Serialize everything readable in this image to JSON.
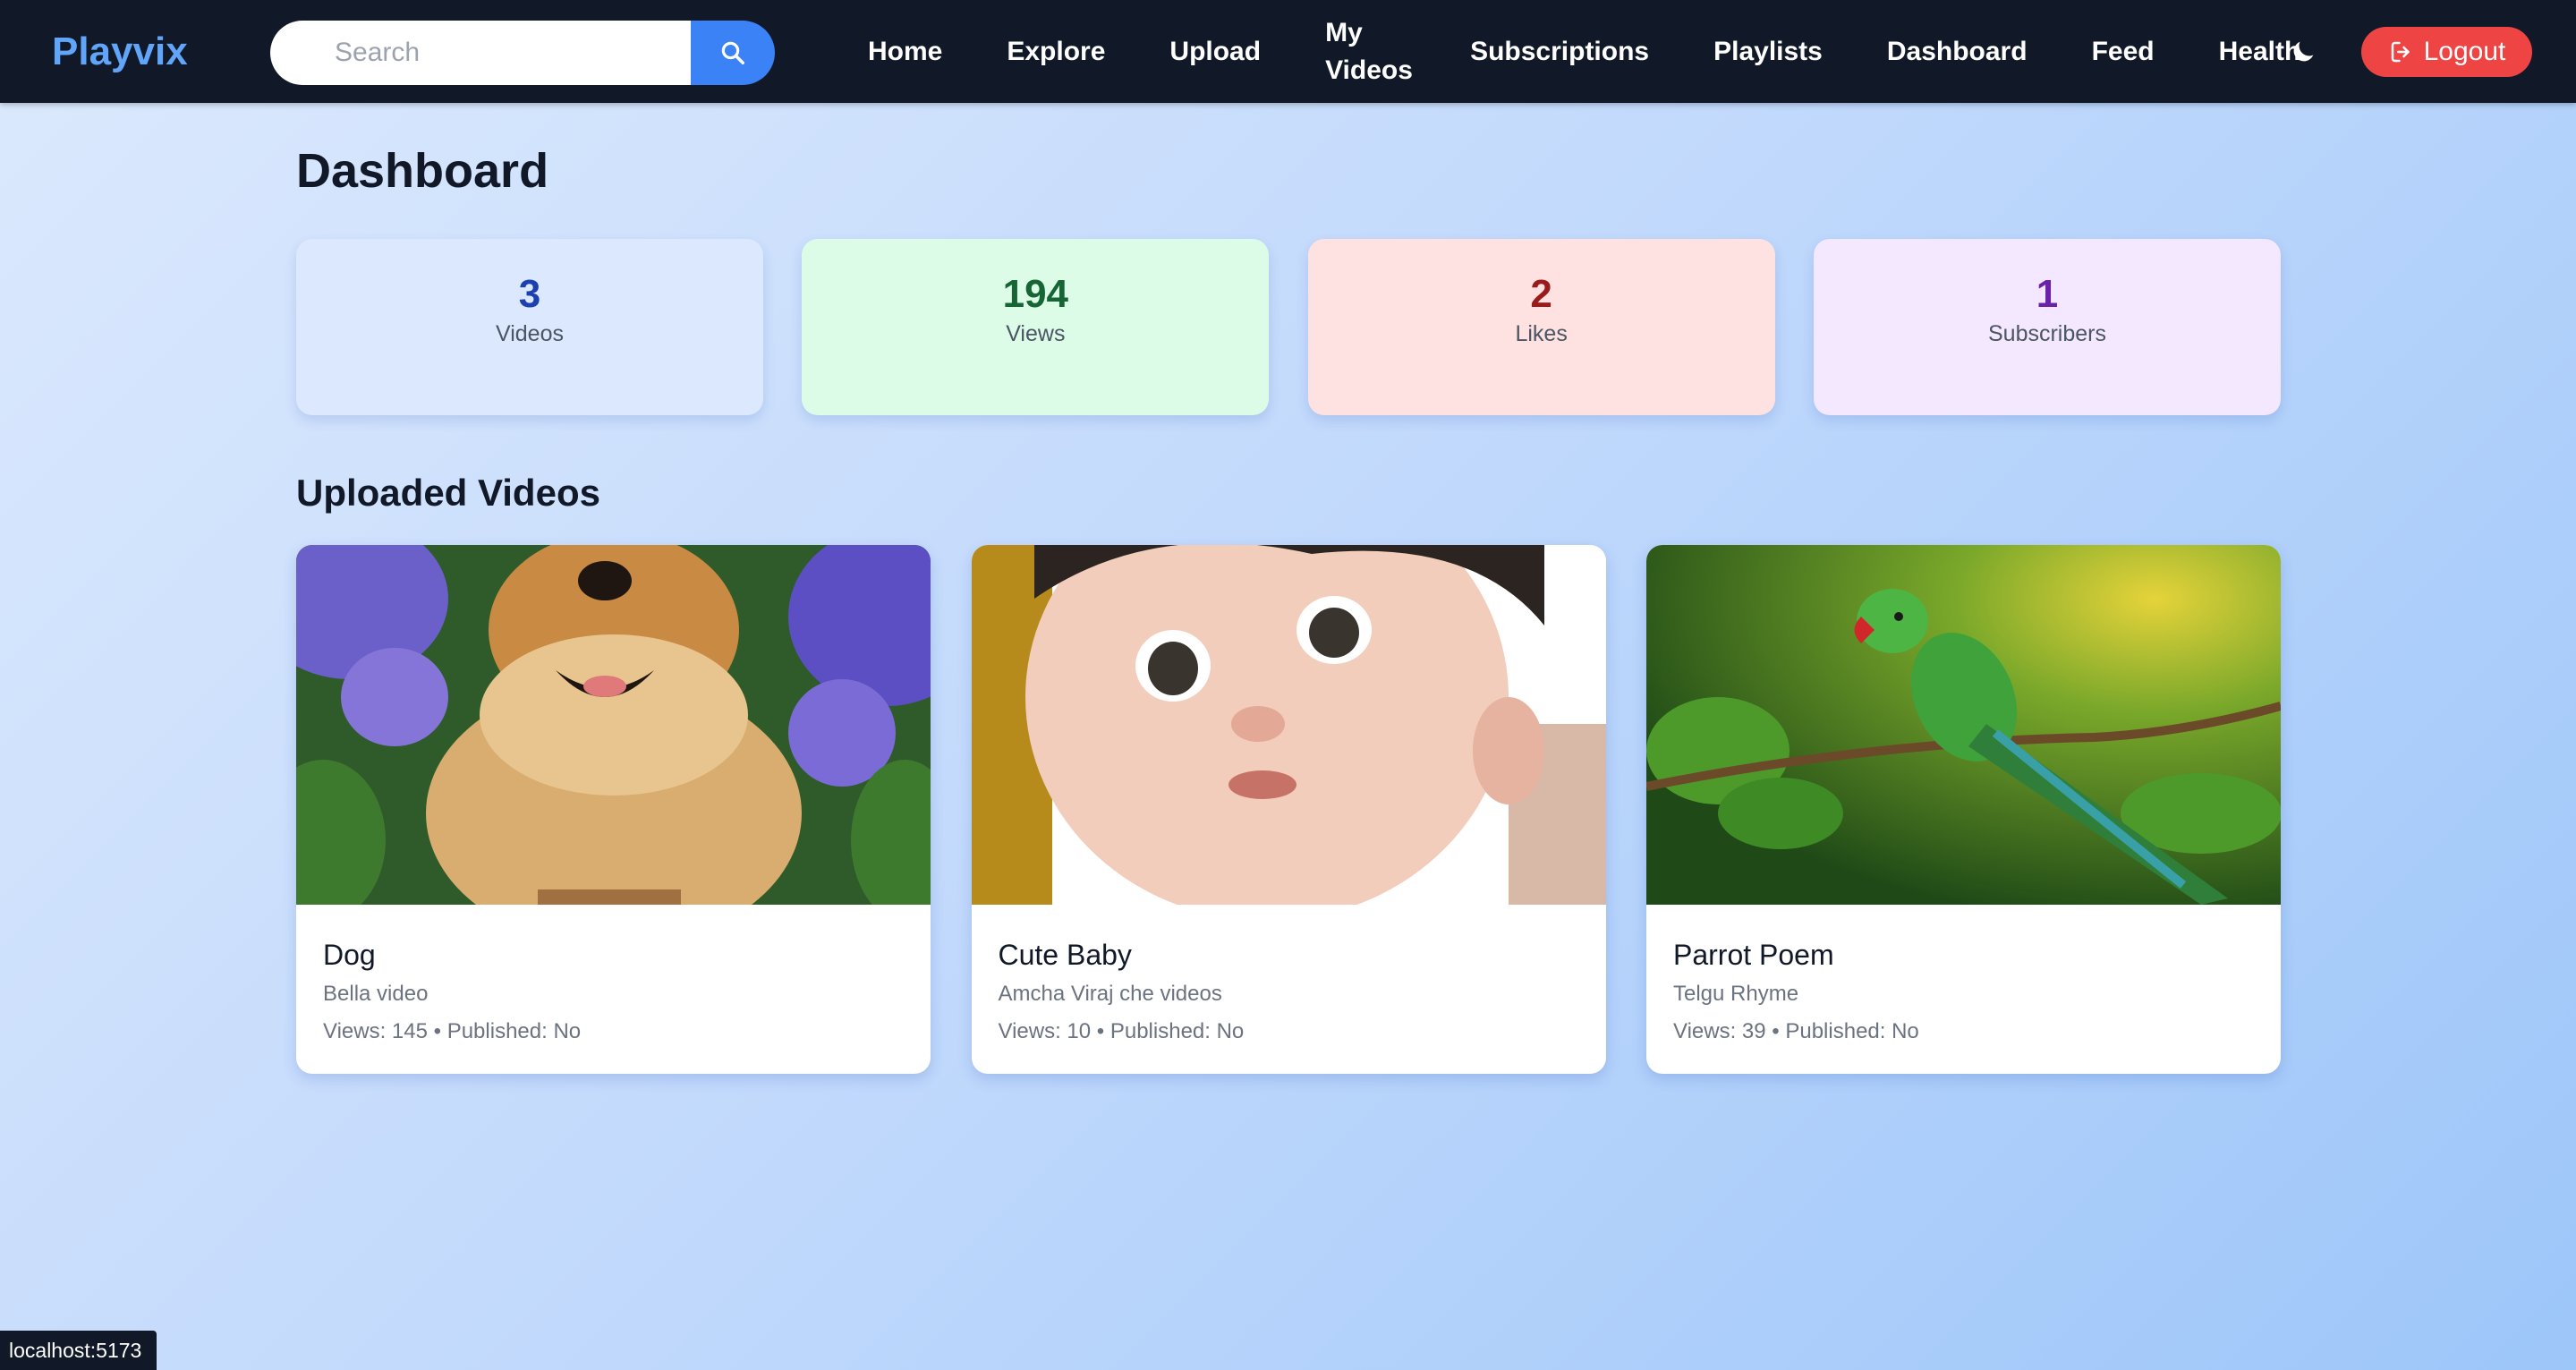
{
  "header": {
    "brand": "Playvix",
    "search_placeholder": "Search",
    "nav": [
      "Home",
      "Explore",
      "Upload",
      "My Videos",
      "Subscriptions",
      "Playlists",
      "Dashboard",
      "Feed",
      "Health"
    ],
    "logout_label": "Logout"
  },
  "main": {
    "title": "Dashboard",
    "stats": [
      {
        "value": "3",
        "label": "Videos",
        "color": "#1e40af"
      },
      {
        "value": "194",
        "label": "Views",
        "color": "#166534"
      },
      {
        "value": "2",
        "label": "Likes",
        "color": "#991b1b"
      },
      {
        "value": "1",
        "label": "Subscribers",
        "color": "#6b21a8"
      }
    ],
    "section_title": "Uploaded Videos",
    "videos": [
      {
        "title": "Dog",
        "description": "Bella video",
        "meta": "Views: 145 • Published: No",
        "thumbnail": "puppy-in-flowers"
      },
      {
        "title": "Cute Baby",
        "description": "Amcha Viraj che videos",
        "meta": "Views: 10 • Published: No",
        "thumbnail": "baby-face"
      },
      {
        "title": "Parrot Poem",
        "description": "Telgu Rhyme",
        "meta": "Views: 39 • Published: No",
        "thumbnail": "green-parrot-on-branch"
      }
    ]
  },
  "statusbar": {
    "url": "localhost:5173"
  },
  "colors": {
    "navbar": "#111827",
    "brand": "#60a5fa",
    "accent": "#3b82f6",
    "logout": "#ef4444"
  }
}
